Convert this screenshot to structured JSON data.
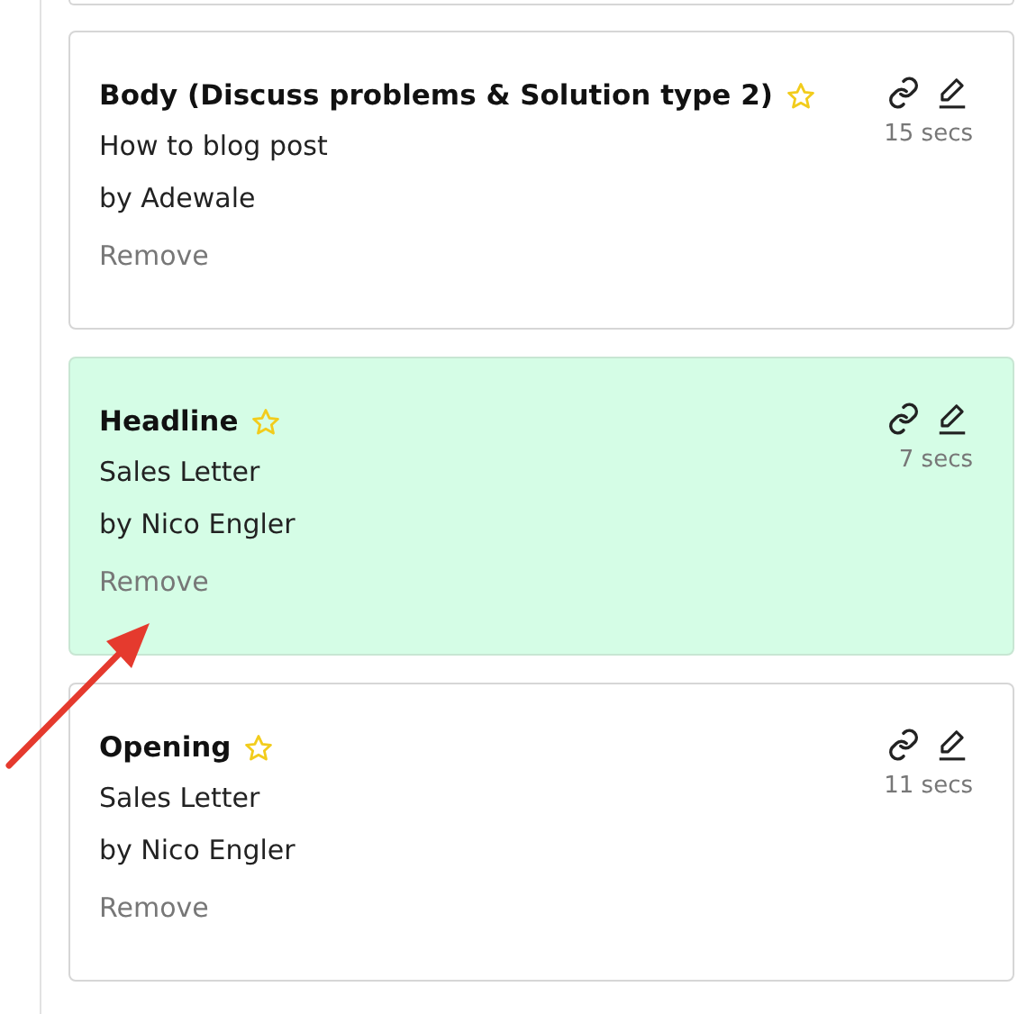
{
  "cards": [
    {
      "title": "Body (Discuss problems & Solution type 2)",
      "subtitle": "How to blog post",
      "author": "by Adewale",
      "action": "Remove",
      "duration": "15 secs",
      "selected": false
    },
    {
      "title": "Headline",
      "subtitle": "Sales Letter",
      "author": "by Nico Engler",
      "action": "Remove",
      "duration": "7 secs",
      "selected": true
    },
    {
      "title": "Opening",
      "subtitle": "Sales Letter",
      "author": "by Nico Engler",
      "action": "Remove",
      "duration": "11 secs",
      "selected": false
    }
  ]
}
